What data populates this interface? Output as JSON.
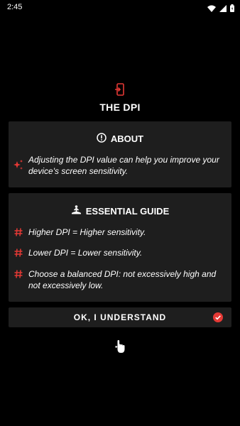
{
  "status_bar": {
    "time": "2:45"
  },
  "header": {
    "title": "THE DPI"
  },
  "about": {
    "title": "ABOUT",
    "text": "Adjusting the DPI value can help you improve your device's screen sensitivity."
  },
  "guide": {
    "title": "ESSENTIAL GUIDE",
    "items": [
      {
        "text": "Higher DPI = Higher sensitivity."
      },
      {
        "text": "Lower DPI = Lower sensitivity."
      },
      {
        "text": "Choose a balanced DPI: not excessively high and not excessively low."
      }
    ]
  },
  "ok_button": {
    "label": "OK, I UNDERSTAND"
  },
  "colors": {
    "accent": "#e53935",
    "card": "#1e1e1e",
    "background": "#000000"
  }
}
